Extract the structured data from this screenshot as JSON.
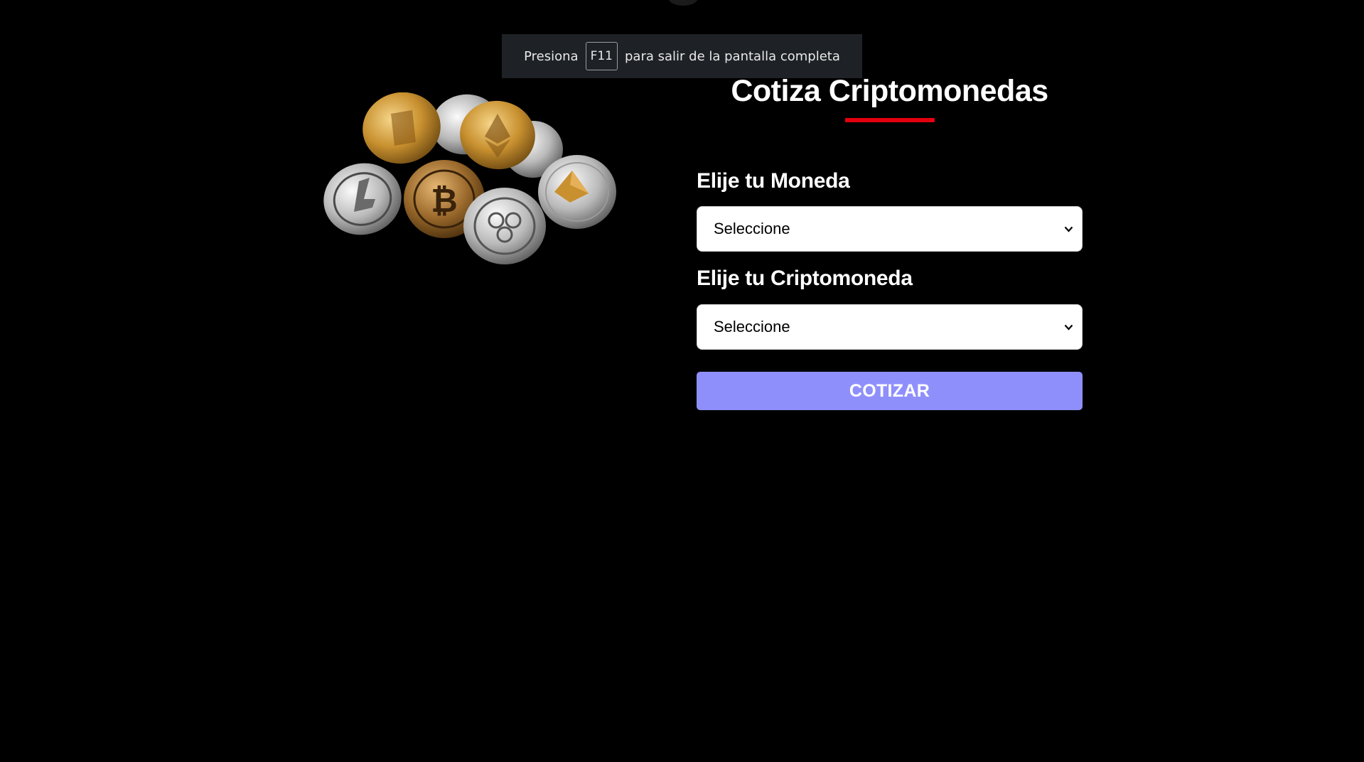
{
  "fullscreen_notice": {
    "prefix": "Presiona",
    "key": "F11",
    "suffix": "para salir de la pantalla completa"
  },
  "hero_image": {
    "icon": "crypto-coins-image"
  },
  "form": {
    "title": "Cotiza Criptomonedas",
    "moneda_label": "Elije tu Moneda",
    "moneda_value": "Seleccione",
    "cripto_label": "Elije tu Criptomoneda",
    "cripto_value": "Seleccione",
    "submit_label": "COTIZAR"
  },
  "colors": {
    "background": "#000000",
    "accent_underline": "#e3000f",
    "button": "#8f8ffc",
    "notice_bg": "#1e2125"
  }
}
